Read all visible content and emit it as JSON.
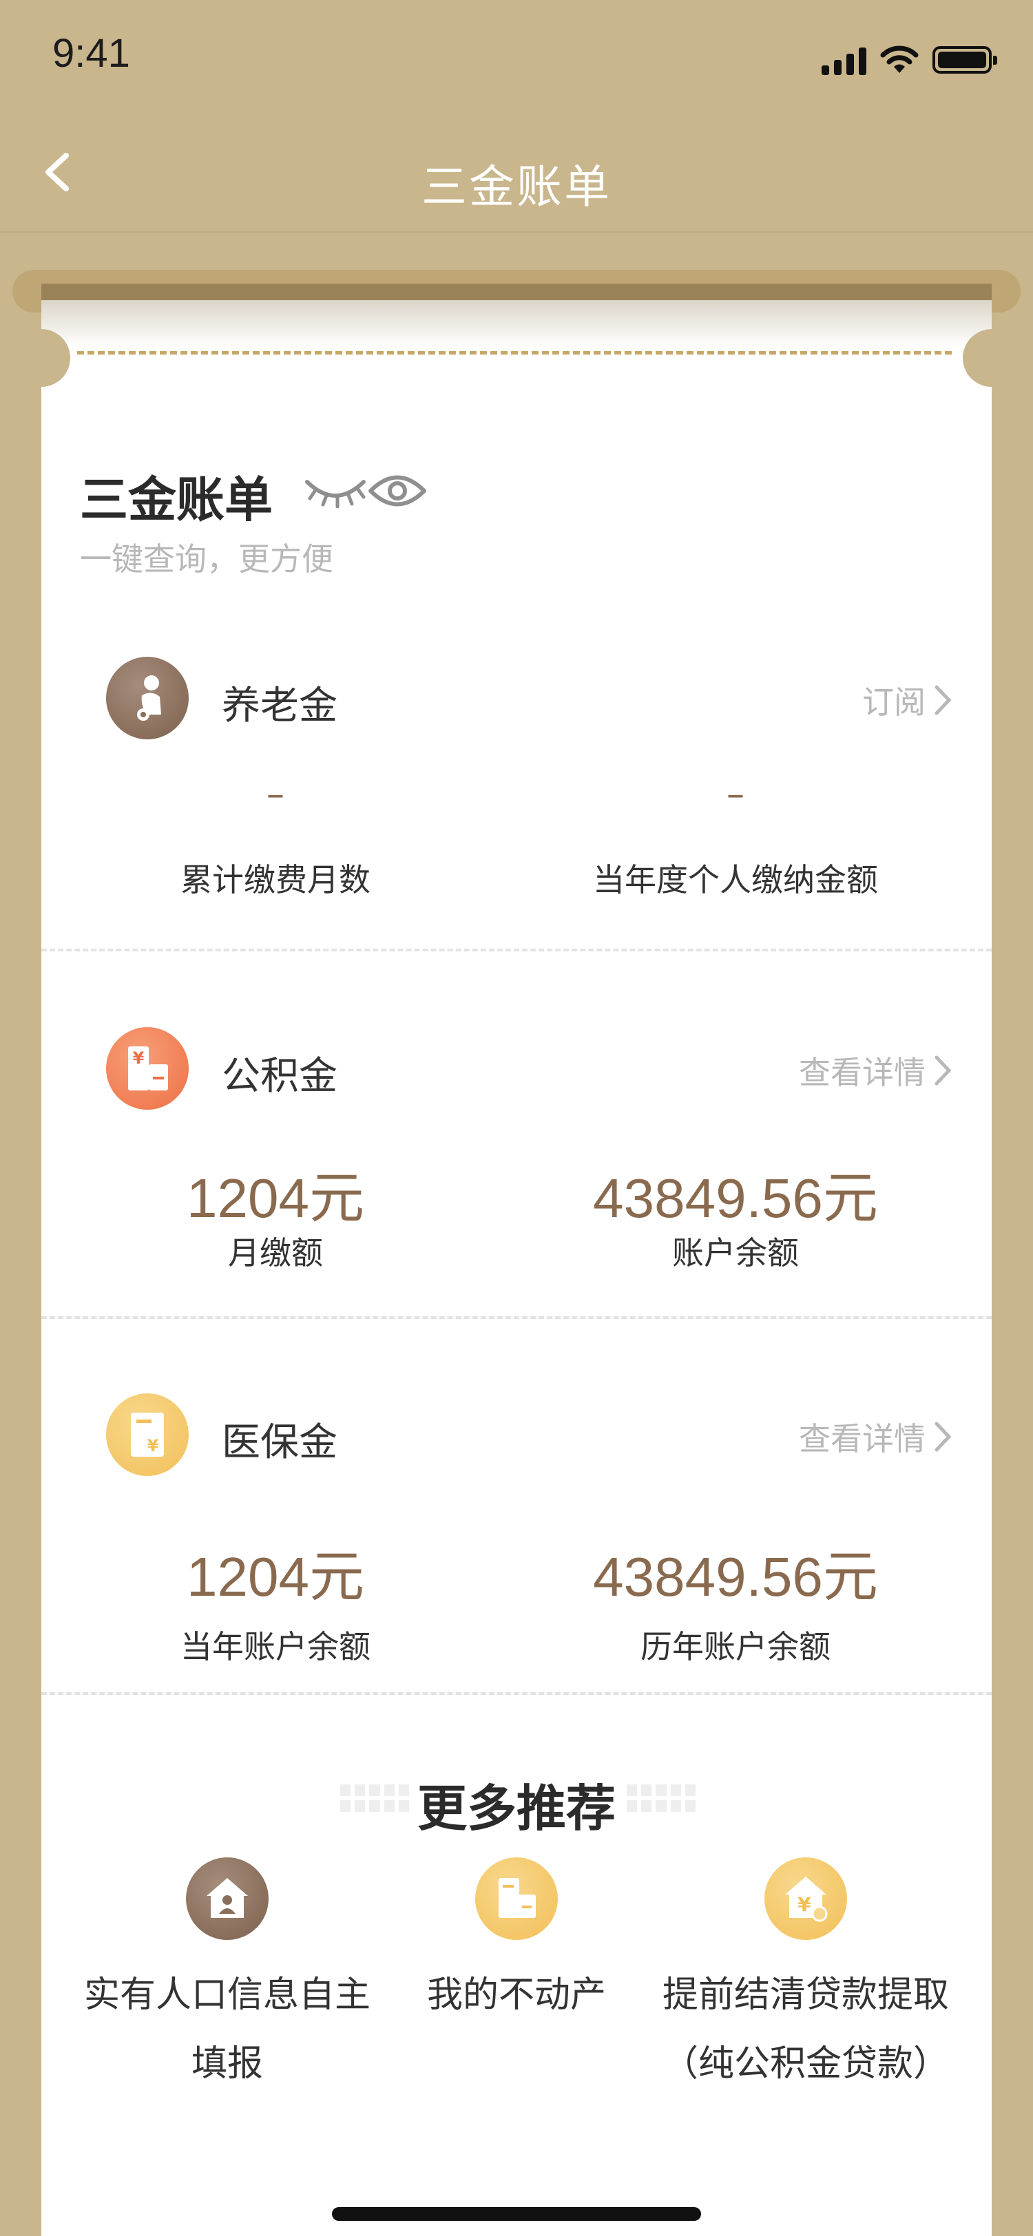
{
  "status_bar": {
    "time": "9:41"
  },
  "nav": {
    "title": "三金账单"
  },
  "card": {
    "title": "三金账单",
    "subtitle": "一键查询，更方便"
  },
  "pension": {
    "name": "养老金",
    "action": "订阅",
    "stats": [
      {
        "value": "–",
        "label": "累计缴费月数"
      },
      {
        "value": "–",
        "label": "当年度个人缴纳金额"
      }
    ]
  },
  "housing_fund": {
    "name": "公积金",
    "action": "查看详情",
    "stats": [
      {
        "value": "1204元",
        "label": "月缴额"
      },
      {
        "value": "43849.56元",
        "label": "账户余额"
      }
    ]
  },
  "medical": {
    "name": "医保金",
    "action": "查看详情",
    "stats": [
      {
        "value": "1204元",
        "label": "当年账户余额"
      },
      {
        "value": "43849.56元",
        "label": "历年账户余额"
      }
    ]
  },
  "more": {
    "title": "更多推荐",
    "items": [
      {
        "label_line1": "实有人口信息自主",
        "label_line2": "填报"
      },
      {
        "label_line1": "我的不动产",
        "label_line2": ""
      },
      {
        "label_line1": "提前结清贷款提取",
        "label_line2": "（纯公积金贷款）"
      }
    ]
  },
  "colors": {
    "background": "#c9b68c",
    "value_brown": "#8a6a4e",
    "pension_icon": "#8a6e5c",
    "housing_icon": "#f07f52",
    "medical_icon": "#f5c766"
  }
}
